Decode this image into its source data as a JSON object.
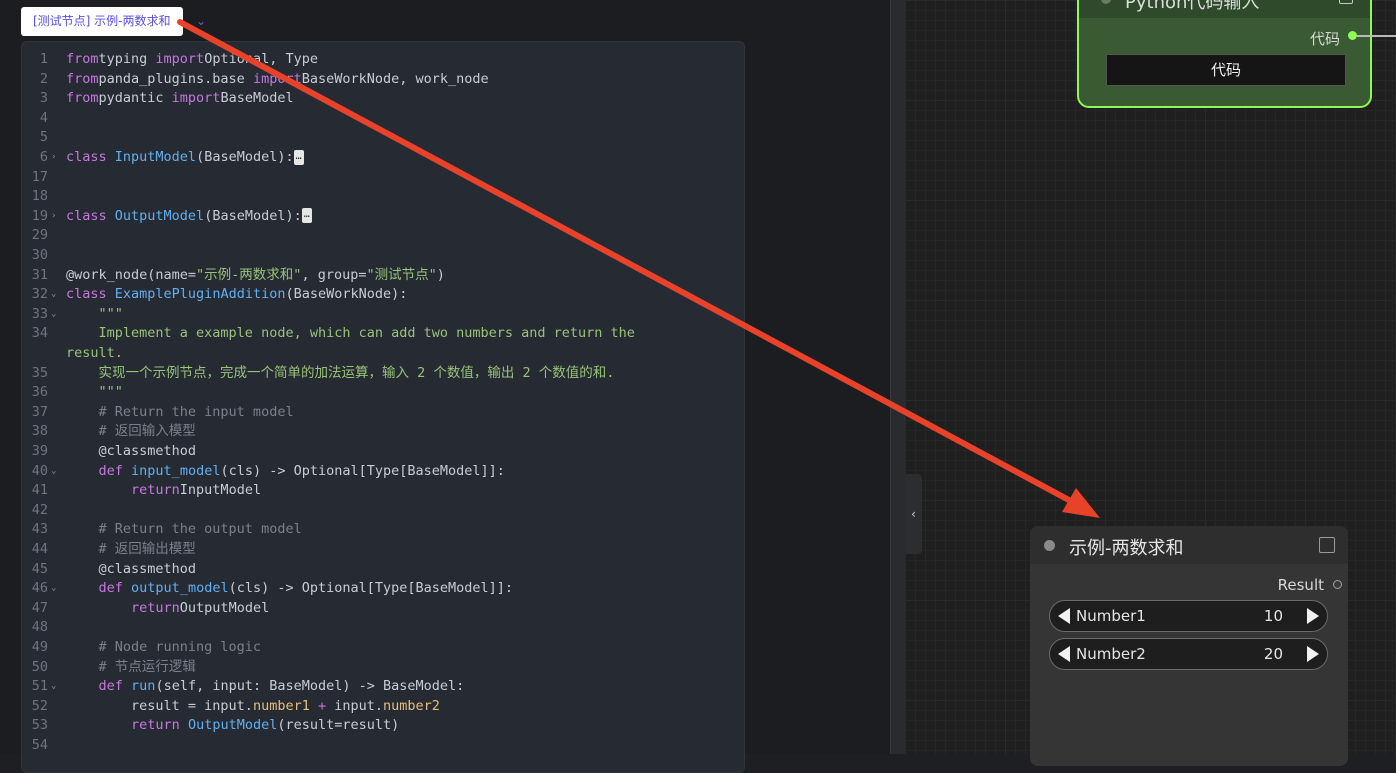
{
  "tag": {
    "label": "[测试节点] 示例-两数求和"
  },
  "editor": {
    "lines": [
      {
        "n": "1",
        "fold": ""
      },
      {
        "n": "2",
        "fold": ""
      },
      {
        "n": "3",
        "fold": ""
      },
      {
        "n": "4",
        "fold": ""
      },
      {
        "n": "5",
        "fold": ""
      },
      {
        "n": "6",
        "fold": "›"
      },
      {
        "n": "17",
        "fold": ""
      },
      {
        "n": "18",
        "fold": ""
      },
      {
        "n": "19",
        "fold": "›"
      },
      {
        "n": "29",
        "fold": ""
      },
      {
        "n": "30",
        "fold": ""
      },
      {
        "n": "31",
        "fold": ""
      },
      {
        "n": "32",
        "fold": "⌄"
      },
      {
        "n": "33",
        "fold": "⌄"
      },
      {
        "n": "34",
        "fold": ""
      },
      {
        "n": "",
        "fold": ""
      },
      {
        "n": "35",
        "fold": ""
      },
      {
        "n": "36",
        "fold": ""
      },
      {
        "n": "37",
        "fold": ""
      },
      {
        "n": "38",
        "fold": ""
      },
      {
        "n": "39",
        "fold": ""
      },
      {
        "n": "40",
        "fold": "⌄"
      },
      {
        "n": "41",
        "fold": ""
      },
      {
        "n": "42",
        "fold": ""
      },
      {
        "n": "43",
        "fold": ""
      },
      {
        "n": "44",
        "fold": ""
      },
      {
        "n": "45",
        "fold": ""
      },
      {
        "n": "46",
        "fold": "⌄"
      },
      {
        "n": "47",
        "fold": ""
      },
      {
        "n": "48",
        "fold": ""
      },
      {
        "n": "49",
        "fold": ""
      },
      {
        "n": "50",
        "fold": ""
      },
      {
        "n": "51",
        "fold": "⌄"
      },
      {
        "n": "52",
        "fold": ""
      },
      {
        "n": "53",
        "fold": ""
      },
      {
        "n": "54",
        "fold": ""
      }
    ],
    "code": [
      [
        [
          "kw",
          "from"
        ],
        [
          "",
          "typing "
        ],
        [
          "kw",
          "import"
        ],
        [
          "",
          "Optional, Type"
        ]
      ],
      [
        [
          "kw",
          "from"
        ],
        [
          "",
          "panda_plugins.base "
        ],
        [
          "kw",
          "import"
        ],
        [
          "",
          "BaseWorkNode, work_node"
        ]
      ],
      [
        [
          "kw",
          "from"
        ],
        [
          "",
          "pydantic "
        ],
        [
          "kw",
          "import"
        ],
        [
          "",
          "BaseModel"
        ]
      ],
      [],
      [],
      [
        [
          "kw",
          "class"
        ],
        [
          "cls",
          "InputModel"
        ],
        [
          "",
          "(BaseModel):"
        ],
        [
          "ell",
          "…"
        ]
      ],
      [],
      [],
      [
        [
          "kw",
          "class"
        ],
        [
          "cls",
          "OutputModel"
        ],
        [
          "",
          "(BaseModel):"
        ],
        [
          "ell",
          "…"
        ]
      ],
      [],
      [],
      [
        [
          "",
          "@work_node(name="
        ],
        [
          "str",
          "\"示例-两数求和\""
        ],
        [
          "",
          ", group="
        ],
        [
          "str",
          "\"测试节点\""
        ],
        [
          "",
          ")"
        ]
      ],
      [
        [
          "kw",
          "class"
        ],
        [
          "cls",
          "ExamplePluginAddition"
        ],
        [
          "",
          "(BaseWorkNode):"
        ]
      ],
      [
        [
          "str",
          "    \"\"\""
        ]
      ],
      [
        [
          "str",
          "    Implement a example node, which can add two numbers and return the"
        ]
      ],
      [
        [
          "str",
          "result."
        ]
      ],
      [
        [
          "str",
          "    实现一个示例节点，完成一个简单的加法运算，输入 2 个数值，输出 2 个数值的和."
        ]
      ],
      [
        [
          "str",
          "    \"\"\""
        ]
      ],
      [
        [
          "cmt",
          "    # Return the input model"
        ]
      ],
      [
        [
          "cmt",
          "    # 返回输入模型"
        ]
      ],
      [
        [
          "",
          "    @classmethod"
        ]
      ],
      [
        [
          "kw",
          "    def"
        ],
        [
          "fn",
          "input_model"
        ],
        [
          "",
          "(cls) -> Optional[Type[BaseModel]]:"
        ]
      ],
      [
        [
          "kw",
          "        return"
        ],
        [
          "",
          "InputModel"
        ]
      ],
      [],
      [
        [
          "cmt",
          "    # Return the output model"
        ]
      ],
      [
        [
          "cmt",
          "    # 返回输出模型"
        ]
      ],
      [
        [
          "",
          "    @classmethod"
        ]
      ],
      [
        [
          "kw",
          "    def"
        ],
        [
          "fn",
          "output_model"
        ],
        [
          "",
          "(cls) -> Optional[Type[BaseModel]]:"
        ]
      ],
      [
        [
          "kw",
          "        return"
        ],
        [
          "",
          "OutputModel"
        ]
      ],
      [],
      [
        [
          "cmt",
          "    # Node running logic"
        ]
      ],
      [
        [
          "cmt",
          "    # 节点运行逻辑"
        ]
      ],
      [
        [
          "kw",
          "    def"
        ],
        [
          "fn",
          "run"
        ],
        [
          "",
          "(self, input: BaseModel) -> BaseModel:"
        ]
      ],
      [
        [
          "",
          "        result = input."
        ],
        [
          "attr",
          "number1"
        ],
        [
          "op",
          " + "
        ],
        [
          "",
          "input."
        ],
        [
          "attr",
          "number2"
        ]
      ],
      [
        [
          "kw",
          "        return"
        ],
        [
          "fn",
          "OutputModel"
        ],
        [
          "",
          "(result=result)"
        ]
      ],
      []
    ]
  },
  "python_node": {
    "title": "Python代码输入",
    "output_label": "代码",
    "field_label": "代码"
  },
  "example_node": {
    "title": "示例-两数求和",
    "result_label": "Result",
    "inputs": [
      {
        "label": "Number1",
        "value": "10"
      },
      {
        "label": "Number2",
        "value": "20"
      }
    ]
  },
  "colors": {
    "arrow": "#e8432a",
    "node_border": "#8dfa55"
  },
  "icons": {
    "collapse": "‹",
    "tag_chevron": "⌄"
  }
}
